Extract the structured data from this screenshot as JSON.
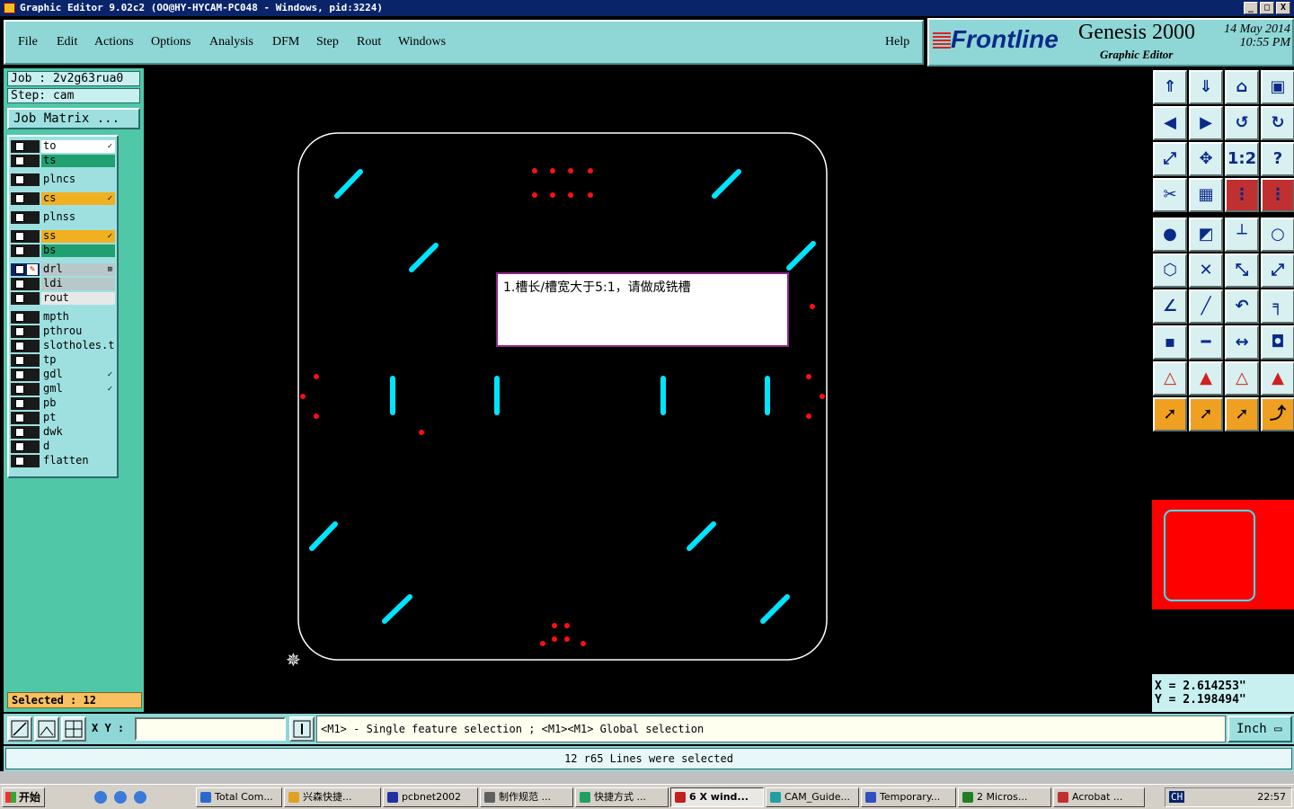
{
  "window": {
    "title": "Graphic Editor 9.02c2 (OO@HY-HYCAM-PC048 - Windows, pid:3224)",
    "buttons": [
      "_",
      "□",
      "X"
    ]
  },
  "menu": [
    "File",
    "Edit",
    "Actions",
    "Options",
    "Analysis",
    "DFM",
    "Step",
    "Rout",
    "Windows",
    "Help"
  ],
  "brand": {
    "logo": "Frontline",
    "product": "Genesis 2000",
    "subtitle": "Graphic Editor",
    "date": "14 May 2014",
    "time": "10:55 PM"
  },
  "job": {
    "job_label": "Job : 2v2g63rua0",
    "step_label": "Step: cam",
    "matrix_button": "Job Matrix ..."
  },
  "layers": [
    {
      "name": "to",
      "color": "#ffffff",
      "flag": "✓"
    },
    {
      "name": "ts",
      "color": "#20a070",
      "flag": ""
    },
    {
      "name": "plncs",
      "color": "#9ee0e0",
      "flag": ""
    },
    {
      "name": "cs",
      "color": "#f0b020",
      "flag": "✓"
    },
    {
      "name": "plnss",
      "color": "#9ee0e0",
      "flag": ""
    },
    {
      "name": "ss",
      "color": "#f0b020",
      "flag": "✓"
    },
    {
      "name": "bs",
      "color": "#20a070",
      "flag": ""
    },
    {
      "name": "drl",
      "color": "#b8c8c8",
      "flag": "⊞"
    },
    {
      "name": "ldi",
      "color": "#b8c8c8",
      "flag": ""
    },
    {
      "name": "rout",
      "color": "#e8e8e8",
      "flag": ""
    },
    {
      "name": "mpth",
      "color": "#9ee0e0",
      "flag": ""
    },
    {
      "name": "pthrou",
      "color": "#9ee0e0",
      "flag": ""
    },
    {
      "name": "slotholes.tx",
      "color": "#9ee0e0",
      "flag": ""
    },
    {
      "name": "tp",
      "color": "#9ee0e0",
      "flag": ""
    },
    {
      "name": "gdl",
      "color": "#9ee0e0",
      "flag": "✓"
    },
    {
      "name": "gml",
      "color": "#9ee0e0",
      "flag": "✓"
    },
    {
      "name": "pb",
      "color": "#9ee0e0",
      "flag": ""
    },
    {
      "name": "pt",
      "color": "#9ee0e0",
      "flag": ""
    },
    {
      "name": "dwk",
      "color": "#9ee0e0",
      "flag": ""
    },
    {
      "name": "d",
      "color": "#9ee0e0",
      "flag": ""
    },
    {
      "name": "flatten",
      "color": "#9ee0e0",
      "flag": ""
    }
  ],
  "selected": "Selected : 12",
  "message": "1.槽长/槽宽大于5:1，请做成铣槽",
  "coords": {
    "x": "X = 2.614253\"",
    "y": "Y = 2.198494\""
  },
  "command": {
    "xy_label": "X Y :",
    "xy_value": "",
    "hint": "<M1> - Single feature selection ; <M1><M1> Global selection",
    "unit": "Inch"
  },
  "status": "12 r65 Lines were selected",
  "taskbar": {
    "start": "开始",
    "tasks": [
      "Total Com...",
      "兴森快捷...",
      "pcbnet2002",
      "制作规范 ...",
      "快捷方式 ...",
      "6 X wind...",
      "CAM_Guide...",
      "Temporary...",
      "2 Micros...",
      "Acrobat ..."
    ],
    "active_task": 5,
    "ime": "CH",
    "clock": "22:57"
  },
  "colors": {
    "slot": "#00e5ff",
    "drill": "#ff1010",
    "outline": "#ffffff"
  }
}
